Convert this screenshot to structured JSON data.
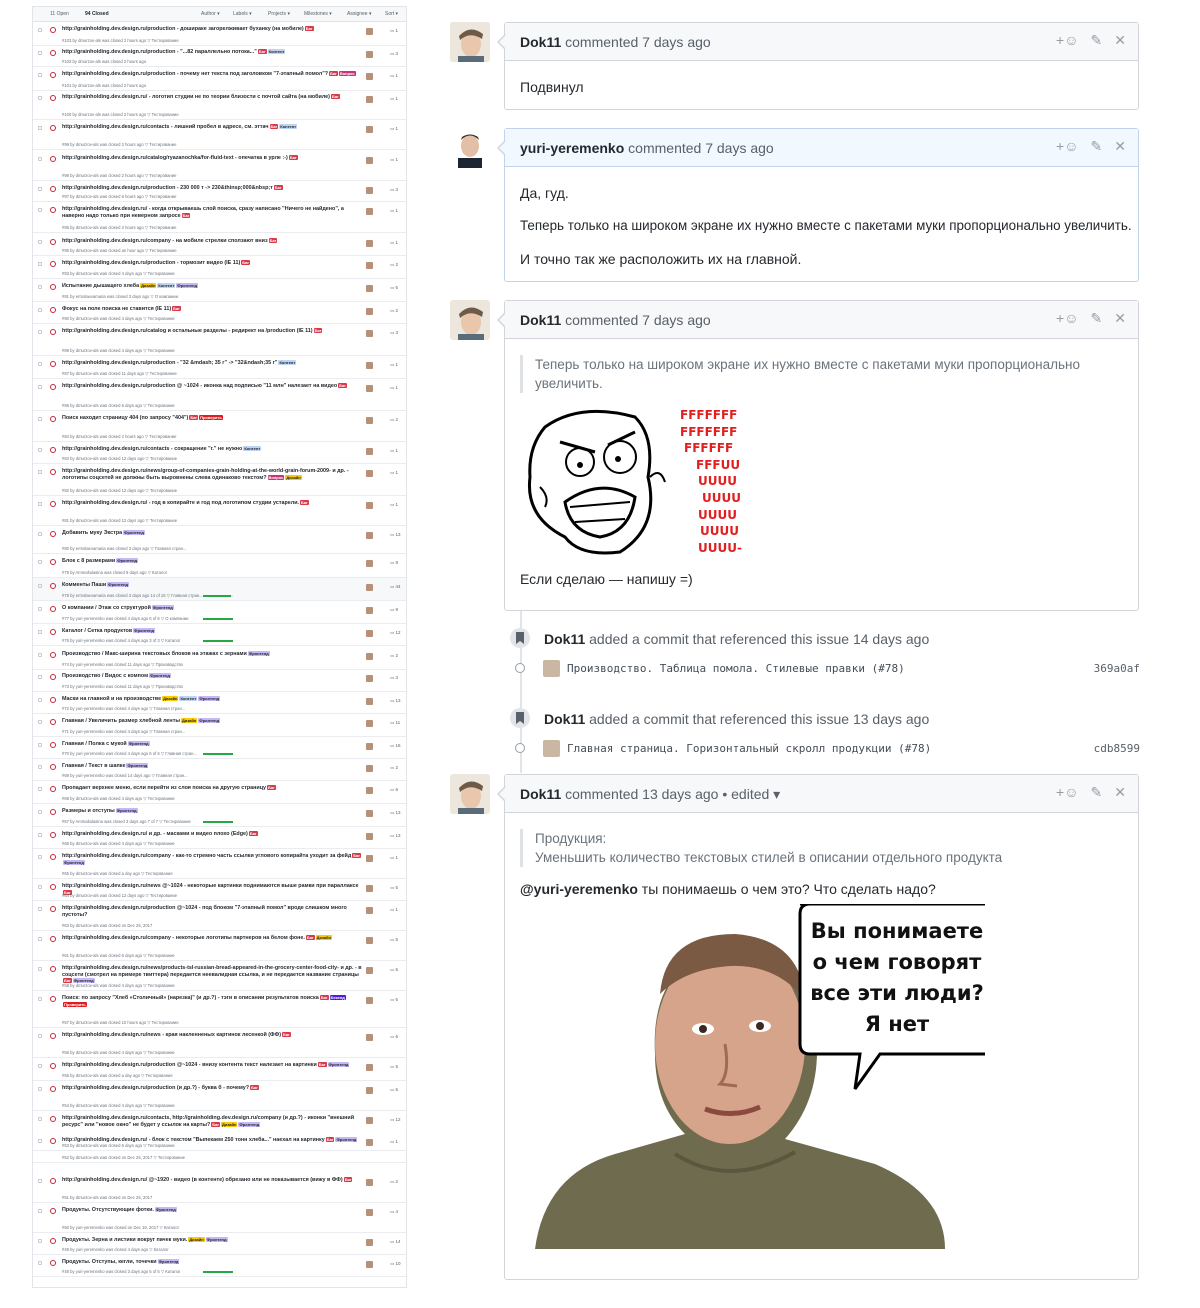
{
  "issue_list": {
    "open_count": "11 Open",
    "closed_count": "94 Closed",
    "filters": [
      "Author ▾",
      "Labels ▾",
      "Projects ▾",
      "Milestones ▾",
      "Assignee ▾",
      "Sort ▾"
    ],
    "rows": [
      {
        "title": "http://grainholding.dev.design.ru/production - дошираке загорелживает буханку (на мобиле)",
        "labels": [
          [
            "Баг",
            "#d73a4a",
            "#fff"
          ]
        ],
        "meta": "#103 by dmurzov-als was closed 2 hours ago  ▽ Тестирование",
        "comments": "1"
      },
      {
        "title": "http://grainholding.dev.design.ru/production - \"...82 параллельно потока...\"",
        "labels": [
          [
            "Баг",
            "#d73a4a",
            "#fff"
          ],
          [
            "Контент",
            "#bfd4f2",
            "#24292e"
          ]
        ],
        "meta": "#102 by dmurzov-als was closed 2 hours ago",
        "comments": "3"
      },
      {
        "title": "http://grainholding.dev.design.ru/production - почему нет текста под заголовком \"7-этапный помол\"?",
        "labels": [
          [
            "Баг",
            "#d73a4a",
            "#fff"
          ],
          [
            "Вопрос",
            "#cc317c",
            "#fff"
          ]
        ],
        "meta": "#101 by dmurzov-als was closed 2 hours ago",
        "comments": "1"
      },
      {
        "title": "http://grainholding.dev.design.ru/ - логотип студии не по теории близости с почтой сайта (на мобиле)",
        "labels": [
          [
            "Баг",
            "#d73a4a",
            "#fff"
          ]
        ],
        "meta": "#100 by dmurzov-als was closed 2 hours ago  ▽ Тестирование",
        "comments": "1"
      },
      {
        "title": "http://grainholding.dev.design.ru/contacts - лишний пробел в адресе, см. эттач",
        "labels": [
          [
            "Баг",
            "#d73a4a",
            "#fff"
          ],
          [
            "Контент",
            "#bfd4f2",
            "#24292e"
          ]
        ],
        "meta": "#99 by dmurzov-als was closed 2 hours ago  ▽ Тестирование",
        "comments": "1"
      },
      {
        "title": "http://grainholding.dev.design.ru/catalog/ryazanochka/for-fluid-text - опечатка в урле :-)",
        "labels": [
          [
            "Баг",
            "#d73a4a",
            "#fff"
          ]
        ],
        "meta": "#98 by dmurzov-als was closed 2 hours ago  ▽ Тестирование",
        "comments": "1"
      },
      {
        "title": "http://grainholding.dev.design.ru/production - 230 000 т -> 230&thinsp;000&nbsp;т",
        "labels": [
          [
            "Баг",
            "#d73a4a",
            "#fff"
          ]
        ],
        "meta": "#97 by dmurzov-als was closed 6 hours ago  ▽ Тестирование",
        "comments": "3"
      },
      {
        "title": "http://grainholding.dev.design.ru/ - когда открываешь слой поиска, сразу написано \"Ничего не найдено\", а наверно надо только при неверном запросе",
        "labels": [
          [
            "Баг",
            "#d73a4a",
            "#fff"
          ]
        ],
        "meta": "#95 by dmurzov-als was closed 2 hours ago  ▽ Тестирование",
        "comments": "1"
      },
      {
        "title": "http://grainholding.dev.design.ru/company - на мобиле стрелки сползают вниз",
        "labels": [
          [
            "Баг",
            "#d73a4a",
            "#fff"
          ]
        ],
        "meta": "#95 by dmurzov-als was closed an hour ago  ▽ Тестирование",
        "comments": "1"
      },
      {
        "title": "http://grainholding.dev.design.ru/production - тормозит видео (IE 11)",
        "labels": [
          [
            "Баг",
            "#d73a4a",
            "#fff"
          ]
        ],
        "meta": "#93 by dmurzov-als was closed 4 days ago  ▽ Тестирование",
        "comments": "2"
      },
      {
        "title": "Испытание дышащего хлеба",
        "labels": [
          [
            "Дизайн",
            "#fbca04",
            "#24292e"
          ],
          [
            "Контент",
            "#bfd4f2",
            "#24292e"
          ],
          [
            "Фронтенд",
            "#c5b8f5",
            "#24292e"
          ]
        ],
        "meta": "#91 by ermolaevamaria was closed 3 days ago  ▽ О компании",
        "comments": "6"
      },
      {
        "title": "Фокус на поле поиска не ставится (IE 11)",
        "labels": [
          [
            "Баг",
            "#d73a4a",
            "#fff"
          ]
        ],
        "meta": "#90 by dmurzov-als was closed 4 days ago  ▽ Тестирование",
        "comments": "2"
      },
      {
        "title": "http://grainholding.dev.design.ru/catalog и остальные разделы - редирект на /production (IE 11)",
        "labels": [
          [
            "Баг",
            "#d73a4a",
            "#fff"
          ]
        ],
        "meta": "#89 by dmurzov-als was closed 4 days ago  ▽ Тестирование",
        "comments": "3"
      },
      {
        "title": "http://grainholding.dev.design.ru/production - \"32 &mdash; 35 г\" -> \"32&ndash;35 г\"",
        "labels": [
          [
            "Контент",
            "#bfd4f2",
            "#24292e"
          ]
        ],
        "meta": "#87 by dmurzov-als was closed 11 days ago  ▽ Тестирование",
        "comments": "1"
      },
      {
        "title": "http://grainholding.dev.design.ru/production @ ~1024 - иконка над подписью \"11 млн\" налезает на видео",
        "labels": [
          [
            "Баг",
            "#d73a4a",
            "#fff"
          ]
        ],
        "meta": "#86 by dmurzov-als was closed 6 days ago  ▽ Тестирование",
        "comments": "1"
      },
      {
        "title": "Поиск находит страницу 404 (по запросу \"404\")",
        "labels": [
          [
            "Баг",
            "#d73a4a",
            "#fff"
          ],
          [
            "Проверить",
            "#e11d21",
            "#fff"
          ]
        ],
        "meta": "#84 by dmurzov-als was closed 2 hours ago  ▽ Тестирование",
        "comments": "2"
      },
      {
        "title": "http://grainholding.dev.design.ru/contacts - сокращение \"г.\" не нужно",
        "labels": [
          [
            "Контент",
            "#bfd4f2",
            "#24292e"
          ]
        ],
        "meta": "#83 by dmurzov-als was closed 12 days ago  ▽ Тестирование",
        "comments": "1"
      },
      {
        "title": "http://grainholding.dev.design.ru/news/group-of-companies-grain-holding-at-the-world-grain-forum-2009- и др. - логотипы соцсетей не должны быть выровнены слева одинаково текстом?",
        "labels": [
          [
            "Вопрос",
            "#cc317c",
            "#fff"
          ],
          [
            "Дизайн",
            "#fbca04",
            "#24292e"
          ]
        ],
        "meta": "#82 by dmurzov-als was closed 12 days ago  ▽ Тестирование",
        "comments": "1"
      },
      {
        "title": "http://grainholding.dev.design.ru/ - год в копирайте и год под логотипом студии устарели.",
        "labels": [
          [
            "Баг",
            "#d73a4a",
            "#fff"
          ]
        ],
        "meta": "#81 by dmurzov-als was closed 12 days ago  ▽ Тестирование",
        "comments": "1"
      },
      {
        "title": "Добавить муку Экстра",
        "labels": [
          [
            "Фронтенд",
            "#c5b8f5",
            "#24292e"
          ]
        ],
        "meta": "#80 by ermolaevamaria was closed 3 days ago  ▽ Главная стран...",
        "comments": "13"
      },
      {
        "title": "Блок с 8 размерами",
        "labels": [
          [
            "Фронтенд",
            "#c5b8f5",
            "#24292e"
          ]
        ],
        "meta": "#79 by Ammaltulasina was closed 9 days ago  ▽ Каталог",
        "comments": "8"
      },
      {
        "title": "Комменты Паши",
        "labels": [
          [
            "Фронтенд",
            "#c5b8f5",
            "#24292e"
          ]
        ],
        "meta": "#78 by ermolaevamaria was closed 3 days ago   14 of 15  ▽ Главная стран...",
        "comments": "44",
        "progress": 0.93,
        "highlight": true
      },
      {
        "title": "О компании / Этаж со структурой",
        "labels": [
          [
            "Фронтенд",
            "#c5b8f5",
            "#24292e"
          ]
        ],
        "meta": "#77 by yuri-yeremenko was closed 4 days ago   6 of 6  ▽ О компании",
        "comments": "9",
        "progress": 1
      },
      {
        "title": "Каталог / Сетка продуктов",
        "labels": [
          [
            "Фронтенд",
            "#c5b8f5",
            "#24292e"
          ]
        ],
        "meta": "#76 by yuri-yeremenko was closed 4 days ago   3 of 3  ▽ Каталог",
        "comments": "12",
        "progress": 1
      },
      {
        "title": "Производство / Макс-ширина текстовых блоков на этажах с зернами",
        "labels": [
          [
            "Фронтенд",
            "#c5b8f5",
            "#24292e"
          ]
        ],
        "meta": "#74 by yuri-yeremenko was closed 11 days ago  ▽ Производство",
        "comments": "2"
      },
      {
        "title": "Производство / Видос с компом",
        "labels": [
          [
            "Фронтенд",
            "#c5b8f5",
            "#24292e"
          ]
        ],
        "meta": "#73 by yuri-yeremenko was closed 11 days ago  ▽ Производство",
        "comments": "3"
      },
      {
        "title": "Маски на главной и на производстве",
        "labels": [
          [
            "Дизайн",
            "#fbca04",
            "#24292e"
          ],
          [
            "Контент",
            "#bfd4f2",
            "#24292e"
          ],
          [
            "Фронтенд",
            "#c5b8f5",
            "#24292e"
          ]
        ],
        "meta": "#72 by yuri-yeremenko was closed 4 days ago  ▽ Главная стран...",
        "comments": "13"
      },
      {
        "title": "Главная / Увеличить размер хлебной ленты",
        "labels": [
          [
            "Дизайн",
            "#fbca04",
            "#24292e"
          ],
          [
            "Фронтенд",
            "#c5b8f5",
            "#24292e"
          ]
        ],
        "meta": "#71 by yuri-yeremenko was closed 4 days ago  ▽ Главная стран...",
        "comments": "11"
      },
      {
        "title": "Главная / Полка с мукой",
        "labels": [
          [
            "Фронтенд",
            "#c5b8f5",
            "#24292e"
          ]
        ],
        "meta": "#70 by yuri-yeremenko was closed 4 days ago   6 of 6  ▽ Главная стран...",
        "comments": "16",
        "progress": 1
      },
      {
        "title": "Главная / Текст в шапке",
        "labels": [
          [
            "Фронтенд",
            "#c5b8f5",
            "#24292e"
          ]
        ],
        "meta": "#69 by yuri-yeremenko was closed 14 days ago  ▽ Главная стран...",
        "comments": "2"
      },
      {
        "title": "Пропадает верхнее меню, если перейти из слоя поиска на другую страницу",
        "labels": [
          [
            "Баг",
            "#d73a4a",
            "#fff"
          ]
        ],
        "meta": "#68 by dmurzov-als was closed 4 days ago  ▽ Тестирование",
        "comments": "6"
      },
      {
        "title": "Размеры и отступы",
        "labels": [
          [
            "Фронтенд",
            "#c5b8f5",
            "#24292e"
          ]
        ],
        "meta": "#67 by Ammaltulasina was closed 3 days ago   7 of 7  ▽ Тестирование",
        "comments": "13",
        "progress": 1
      },
      {
        "title": "http://grainholding.dev.design.ru/ и др. - масками и видео плохо (Edge)",
        "labels": [
          [
            "Баг",
            "#d73a4a",
            "#fff"
          ]
        ],
        "meta": "#66 by dmurzov-als was closed 4 days ago  ▽ Тестирование",
        "comments": "13"
      },
      {
        "title": "http://grainholding.dev.design.ru/company - как-то стремно часть ссылки углового копирайта уходит за фейд",
        "labels": [
          [
            "Баг",
            "#d73a4a",
            "#fff"
          ],
          [
            "Фронтенд",
            "#c5b8f5",
            "#24292e"
          ]
        ],
        "meta": "#65 by dmurzov-als was closed a day ago  ▽ Тестирование",
        "comments": "1"
      },
      {
        "title": "http://grainholding.dev.design.ru/news @~1024 - некоторые картинки поднимаются выше рамки при параллаксе",
        "labels": [
          [
            "Баг",
            "#d73a4a",
            "#fff"
          ]
        ],
        "meta": "#64 by dmurzov-als was closed 12 days ago  ▽ Тестирование",
        "comments": "5"
      },
      {
        "title": "http://grainholding.dev.design.ru/production @~1024 - под блоком \"7-этапный помол\" вроде слишком много пустоты?",
        "labels": [],
        "meta": "#63 by dmurzov-als was closed on Dec 25, 2017",
        "comments": "1"
      },
      {
        "title": "http://grainholding.dev.design.ru/company - некоторые логотипы партнеров на белом фоне.",
        "labels": [
          [
            "Баг",
            "#d73a4a",
            "#fff"
          ],
          [
            "Дизайн",
            "#fbca04",
            "#24292e"
          ]
        ],
        "meta": "#61 by dmurzov-als was closed 6 days ago  ▽ Тестирование",
        "comments": "5"
      },
      {
        "title": "http://grainholding.dev.design.ru/news/products-tsl-russian-bread-appeared-in-the-grocery-center-food-city- и др. - в соцсети (смотрел на примере твиттера) передается неевалидная ссылка, и не передается название страницы",
        "labels": [
          [
            "Баг",
            "#d73a4a",
            "#fff"
          ],
          [
            "Фронтенд",
            "#c5b8f5",
            "#24292e"
          ]
        ],
        "meta": "#58 by dmurzov-als was closed 4 days ago  ▽ Тестирование",
        "comments": "5"
      },
      {
        "title": "Поиск: по запросу \"Хлеб «Столичный» (нарезка)\" (и др.?) - тэги в описании результатов поиска",
        "labels": [
          [
            "Баг",
            "#d73a4a",
            "#fff"
          ],
          [
            "Бекенд",
            "#5319e7",
            "#fff"
          ],
          [
            "Проверить",
            "#e11d21",
            "#fff"
          ]
        ],
        "meta": "#57 by dmurzov-als was closed 10 hours ago  ▽ Тестирование",
        "comments": "6"
      },
      {
        "title": "http://grainholding.dev.design.ru/news - края накленненых картинок лесенкой (ФФ)",
        "labels": [
          [
            "Баг",
            "#d73a4a",
            "#fff"
          ]
        ],
        "meta": "#56 by dmurzov-als was closed 4 days ago  ▽ Тестирование",
        "comments": "6"
      },
      {
        "title": "http://grainholding.dev.design.ru/production @~1024 - внизу контента текст налезает на картинки",
        "labels": [
          [
            "Баг",
            "#d73a4a",
            "#fff"
          ],
          [
            "Фронтенд",
            "#c5b8f5",
            "#24292e"
          ]
        ],
        "meta": "#55 by dmurzov-als was closed a day ago  ▽ Тестирование",
        "comments": "5"
      },
      {
        "title": "http://grainholding.dev.design.ru/production (и др.?) - буква б - почему?",
        "labels": [
          [
            "Баг",
            "#d73a4a",
            "#fff"
          ]
        ],
        "meta": "#54 by dmurzov-als was closed 4 days ago  ▽ Тестирование",
        "comments": "5"
      },
      {
        "title": "http://grainholding.dev.design.ru/contacts, http://grainholding.dev.design.ru/company (и др.?) - иконки \"внешний ресурс\" или \"новое окно\" не будет у ссылок на карты?",
        "labels": [
          [
            "Баг",
            "#d73a4a",
            "#fff"
          ],
          [
            "Дизайн",
            "#fbca04",
            "#24292e"
          ],
          [
            "Фронтенд",
            "#c5b8f5",
            "#24292e"
          ]
        ],
        "meta": "#53 by dmurzov-als was closed 6 days ago  ▽ Тестирование",
        "comments": "12"
      },
      {
        "title": "http://grainholding.dev.design.ru/ - блок с текстом \"Выпекаем 250 тонн хлеба...\" наехал на картинку",
        "labels": [
          [
            "Баг",
            "#d73a4a",
            "#fff"
          ],
          [
            "Фронтенд",
            "#c5b8f5",
            "#24292e"
          ]
        ],
        "meta": "#52 by dmurzov-als was closed on Dec 25, 2017  ▽ Тестирование",
        "comments": "1"
      },
      {
        "title": "http://grainholding.dev.design.ru/ @~1920 - видео (в контенте) обрезано или не показывается (вижу в ФФ)",
        "labels": [
          [
            "Баг",
            "#d73a4a",
            "#fff"
          ]
        ],
        "meta": "#51 by dmurzov-als was closed on Dec 25, 2017",
        "comments": "2"
      },
      {
        "title": "Продукты. Отсутствующие фотки.",
        "labels": [
          [
            "Фронтенд",
            "#c5b8f5",
            "#24292e"
          ]
        ],
        "meta": "#50 by yuri-yeremenko was closed on Dec 19, 2017  ▽ Каталог",
        "comments": "4"
      },
      {
        "title": "Продукты. Зерна и листики вокруг пачек муки.",
        "labels": [
          [
            "Дизайн",
            "#fbca04",
            "#24292e"
          ],
          [
            "Фронтенд",
            "#c5b8f5",
            "#24292e"
          ]
        ],
        "meta": "#49 by yuri-yeremenko was closed 4 days ago  ▽ Каталог",
        "comments": "14"
      },
      {
        "title": "Продукты. Отступы, кегли, точечки",
        "labels": [
          [
            "Фронтенд",
            "#c5b8f5",
            "#24292e"
          ]
        ],
        "meta": "#48 by yuri-yeremenko was closed 3 days ago   5 of 5  ▽ Каталог",
        "comments": "10",
        "progress": 1
      }
    ]
  },
  "timeline": {
    "comment1": {
      "author": "Dok11",
      "time": "commented 7 days ago",
      "body": "Подвинул"
    },
    "comment2": {
      "author": "yuri-yeremenko",
      "time": "commented 7 days ago",
      "p1": "Да, гуд.",
      "p2": "Теперь только на широком экране их нужно вместе с пакетами муки пропорционально увеличить.",
      "p3": "И точно так же расположить их на главной."
    },
    "comment3": {
      "author": "Dok11",
      "time": "commented 7 days ago",
      "quote": "Теперь только на широком экране их нужно вместе с пакетами муки пропорционально увеличить.",
      "rage_lines": [
        "FFFFFFF",
        "FFFFFFF",
        "FFFFFF",
        "FFFUU",
        "UUUU",
        "UUUU",
        "UUUU",
        "UUUU",
        "UUUU-"
      ],
      "body": "Если сделаю — напишу =)"
    },
    "event1": {
      "author": "Dok11",
      "text": "added a commit that referenced this issue 14 days ago",
      "commit": "Производство. Таблица помола. Стилевые правки (#78)",
      "sha": "369a0af"
    },
    "event2": {
      "author": "Dok11",
      "text": "added a commit that referenced this issue 13 days ago",
      "commit": "Главная страница. Горизонтальный скролл продукции (#78)",
      "sha": "cdb8599"
    },
    "comment4": {
      "author": "Dok11",
      "time": "commented 13 days ago • edited ▾",
      "quote1": "Продукция:",
      "quote2": "Уменьшить количество текстовых стилей в описании отдельного продукта",
      "mention": "@yuri-yeremenko",
      "body": " ты понимаешь о чем это? Что сделать надо?",
      "speech": [
        "Вы понимаете",
        "о чем говорят",
        "все эти люди?",
        "Я нет"
      ]
    },
    "tools": {
      "emoji": "+☺",
      "edit": "✎",
      "close": "✕"
    }
  }
}
